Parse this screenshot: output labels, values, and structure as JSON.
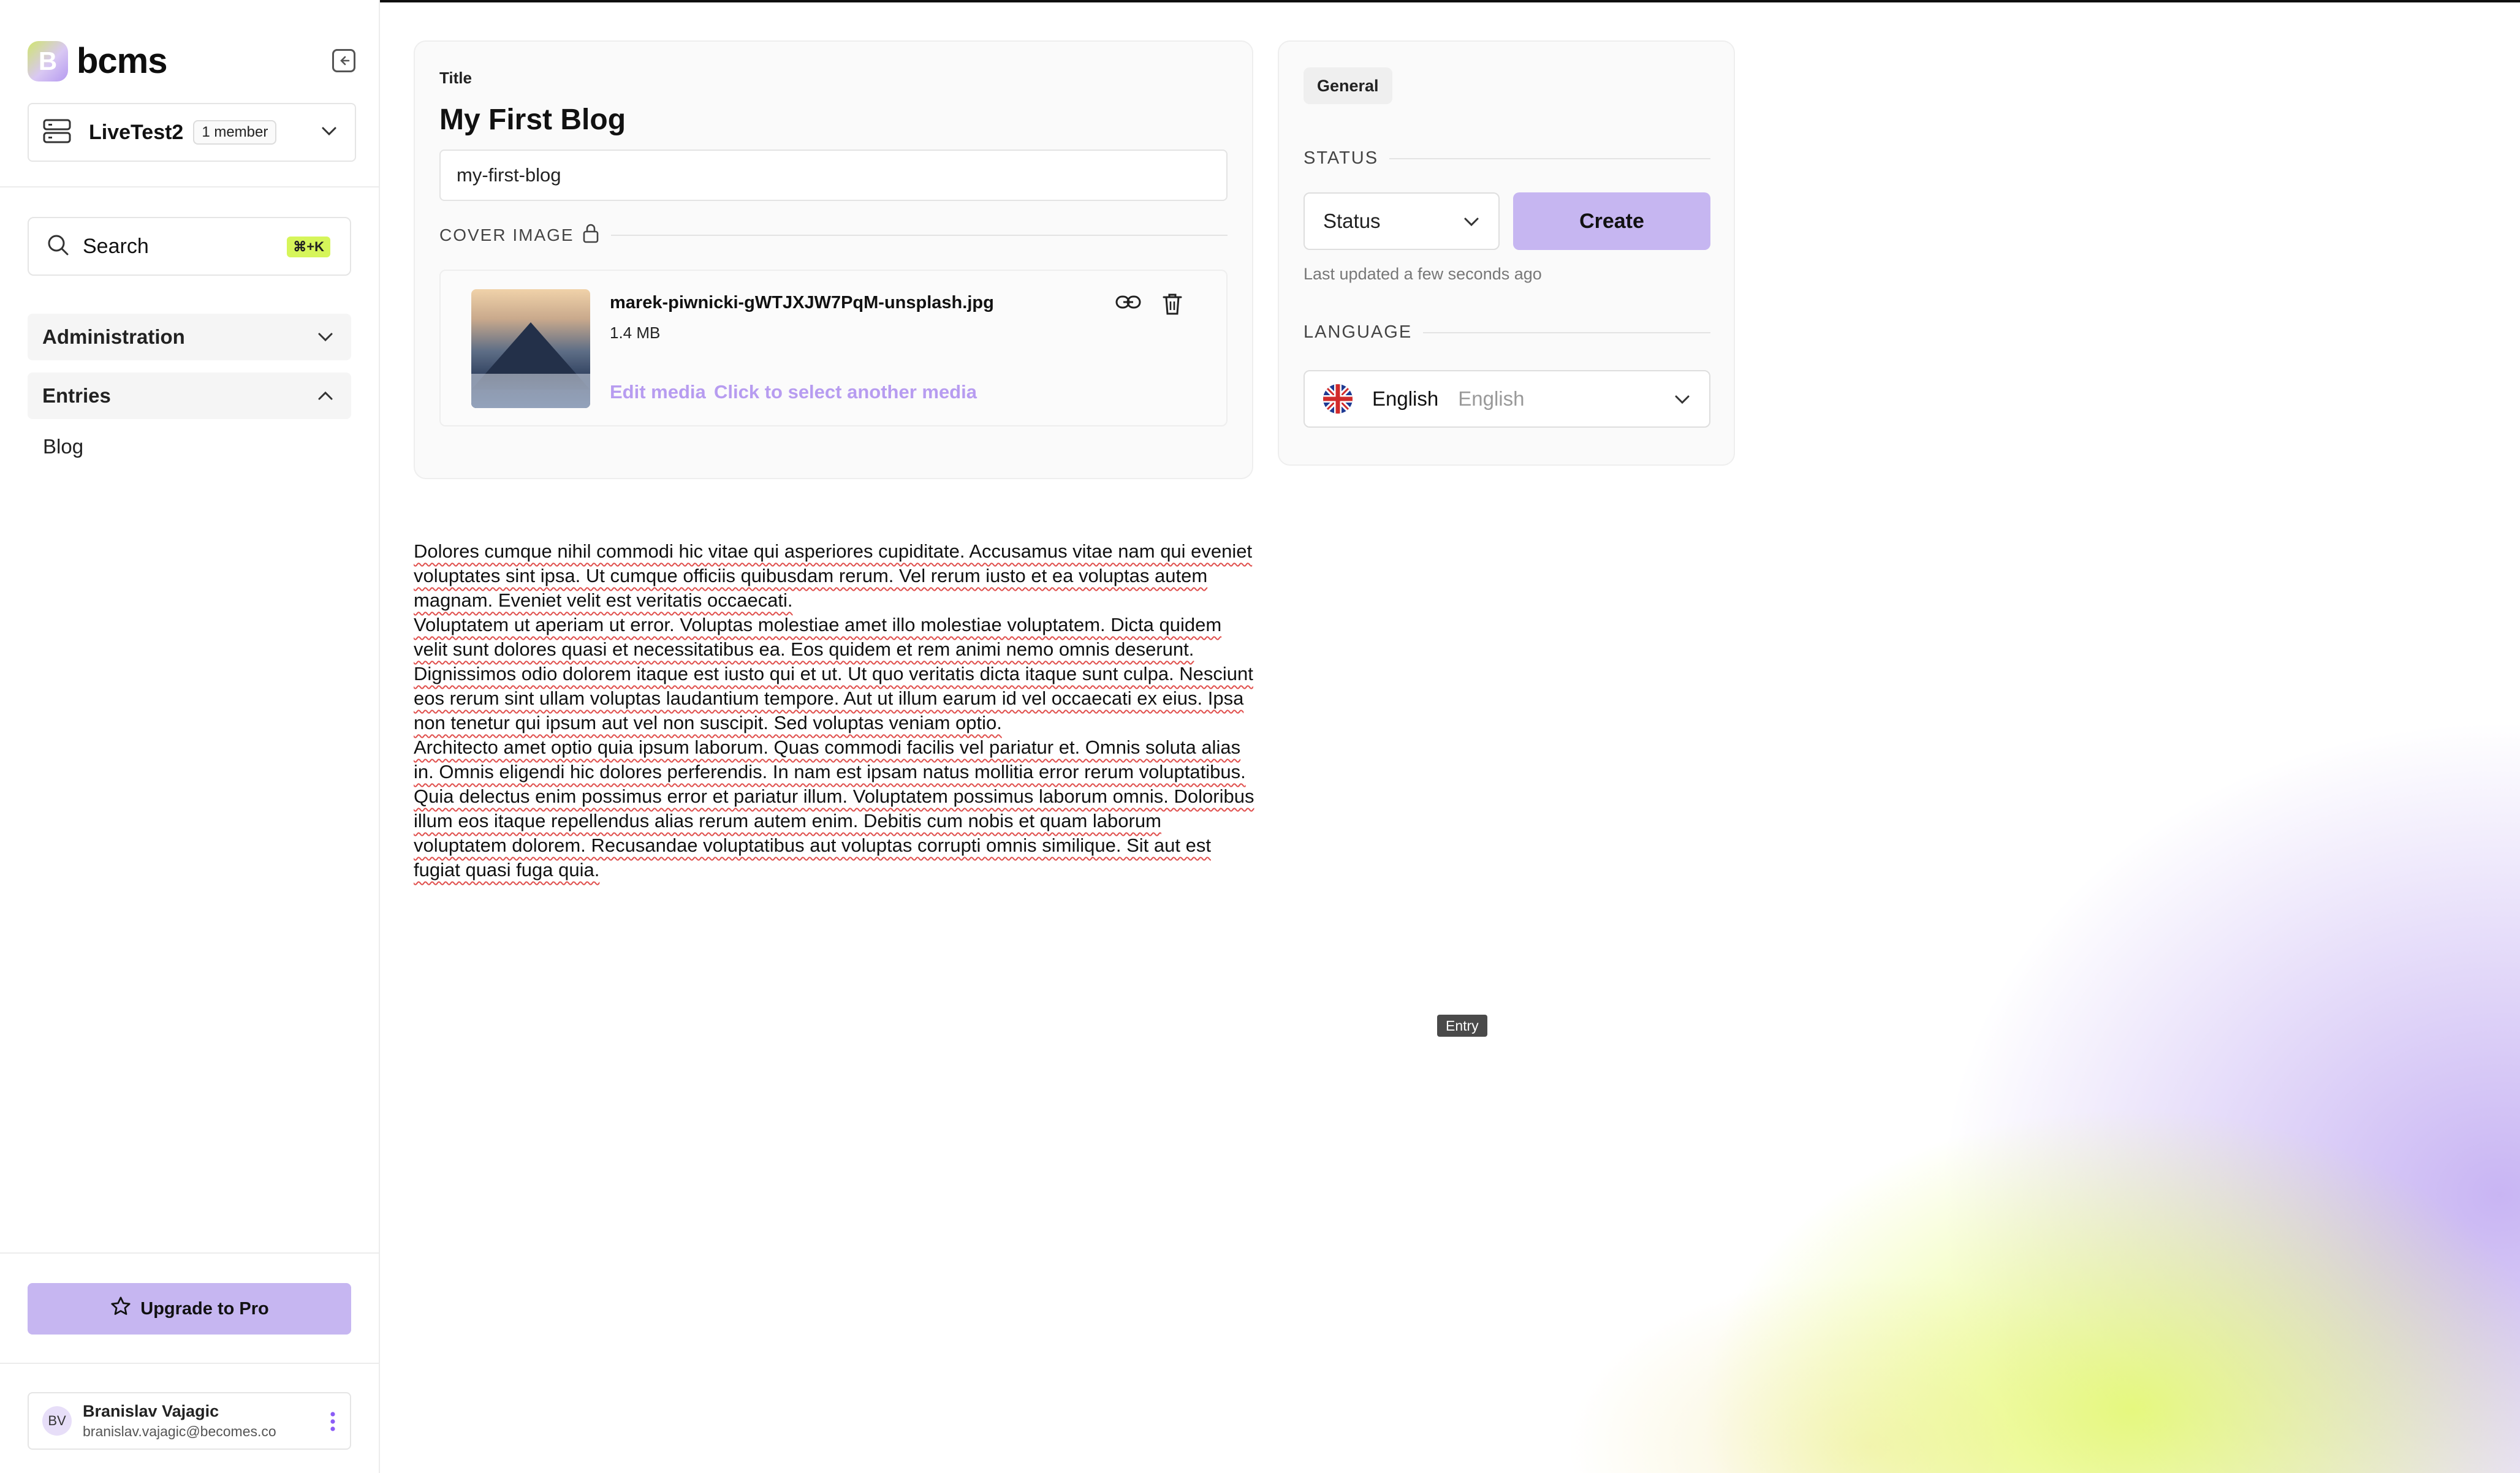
{
  "app": {
    "logo_letter": "B",
    "name": "bcms"
  },
  "sidebar": {
    "project": {
      "name": "LiveTest2",
      "members_badge": "1 member"
    },
    "search": {
      "label": "Search",
      "shortcut": "⌘+K"
    },
    "nav": [
      {
        "label": "Administration",
        "expanded": false
      },
      {
        "label": "Entries",
        "expanded": true
      }
    ],
    "entries_sub": [
      "Blog"
    ],
    "upgrade_label": "Upgrade to Pro",
    "user": {
      "initials": "BV",
      "name": "Branislav Vajagic",
      "email": "branislav.vajagic@becomes.co"
    }
  },
  "entry": {
    "title_label": "Title",
    "title": "My First Blog",
    "slug": "my-first-blog",
    "cover_image_label": "COVER IMAGE",
    "media": {
      "file_name": "marek-piwnicki-gWTJXJW7PqM-unsplash.jpg",
      "file_size": "1.4 MB",
      "edit_label": "Edit media",
      "select_label": "Click to select another media"
    }
  },
  "side_panel": {
    "tab_label": "General",
    "status_section": "STATUS",
    "status_placeholder": "Status",
    "create_label": "Create",
    "last_updated": "Last updated a few seconds ago",
    "language_section": "LANGUAGE",
    "language_name": "English",
    "language_native": "English"
  },
  "content": {
    "paragraphs": [
      "Dolores cumque nihil commodi hic vitae qui asperiores cupiditate. Accusamus vitae nam qui eveniet voluptates sint ipsa. Ut cumque officiis quibusdam rerum. Vel rerum iusto et ea voluptas autem magnam. Eveniet velit est veritatis occaecati.",
      "Voluptatem ut aperiam ut error. Voluptas molestiae amet illo molestiae voluptatem. Dicta quidem velit sunt dolores quasi et necessitatibus ea. Eos quidem et rem animi nemo omnis deserunt. Dignissimos odio dolorem itaque est iusto qui et ut. Ut quo veritatis dicta itaque sunt culpa. Nesciunt eos rerum sint ullam voluptas laudantium tempore. Aut ut illum earum id vel occaecati ex eius. Ipsa non tenetur qui ipsum aut vel non suscipit. Sed voluptas veniam optio.",
      "Architecto amet optio quia ipsum laborum. Quas commodi facilis vel pariatur et. Omnis soluta alias in. Omnis eligendi hic dolores perferendis. In nam est ipsam natus mollitia error rerum voluptatibus. Quia delectus enim possimus error et pariatur illum. Voluptatem possimus laborum omnis. Doloribus illum eos itaque repellendus alias rerum autem enim. Debitis cum nobis et quam laborum voluptatem dolorem. Recusandae voluptatibus aut voluptas corrupti omnis similique. Sit aut est fugiat quasi fuga quia."
    ]
  },
  "tooltip": "Entry",
  "colors": {
    "accent_purple": "#c6b6f1",
    "link_purple": "#b79cf0",
    "shortcut_lime": "#d6f55a"
  }
}
